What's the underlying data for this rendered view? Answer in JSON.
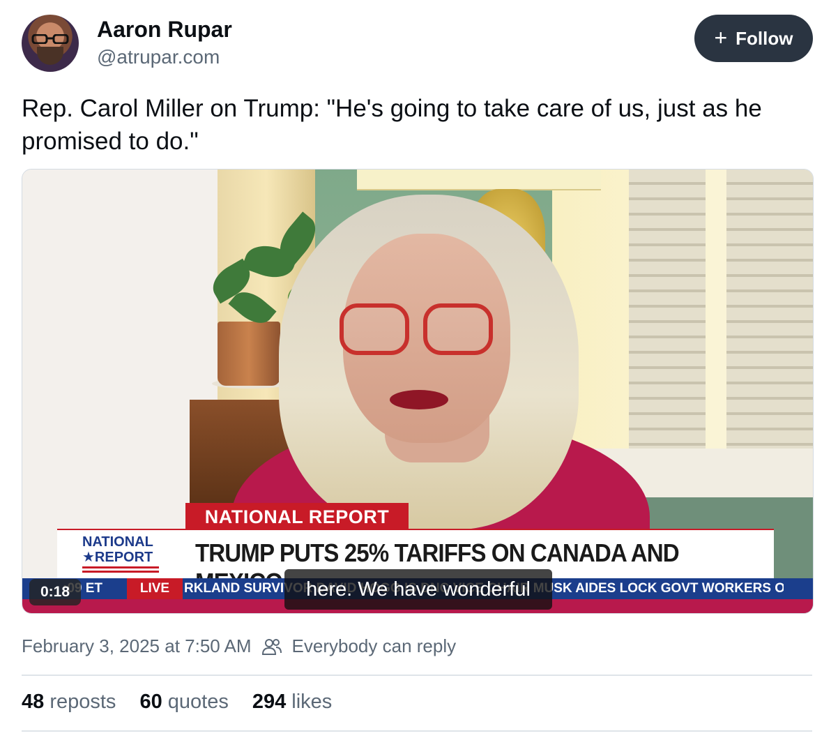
{
  "author": {
    "name": "Aaron Rupar",
    "handle": "@atrupar.com"
  },
  "follow_button": {
    "icon": "plus-icon",
    "label": "Follow"
  },
  "post": {
    "text": "Rep. Carol Miller on Trump: \"He's going to take care of us, just as he promised to do.\""
  },
  "video": {
    "chyron_tag": "NATIONAL REPORT",
    "logo_line1": "NATIONAL",
    "logo_line2": "★REPORT",
    "headline": "TRUMP PUTS 25% TARIFFS ON CANADA AND MEXICO",
    "ticker_time": ":09 ET",
    "ticker_live": "LIVE",
    "ticker_text": "RKLAND SURVIVOR DAVID HOGG IS DNC VICE CHAIR   MUSK AIDES LOCK GOVT WORKERS OU",
    "caption": "here. We have wonderful",
    "elapsed": "0:18"
  },
  "meta": {
    "timestamp": "February 3, 2025 at 7:50 AM",
    "reply_setting_icon": "people-icon",
    "reply_setting": "Everybody can reply"
  },
  "stats": [
    {
      "count": "48",
      "label": "reposts"
    },
    {
      "count": "60",
      "label": "quotes"
    },
    {
      "count": "294",
      "label": "likes"
    }
  ],
  "colors": {
    "follow_bg": "#2a3441",
    "secondary_text": "#5b6876",
    "chyron_red": "#c81b27",
    "ticker_blue": "#1b3e8c"
  }
}
